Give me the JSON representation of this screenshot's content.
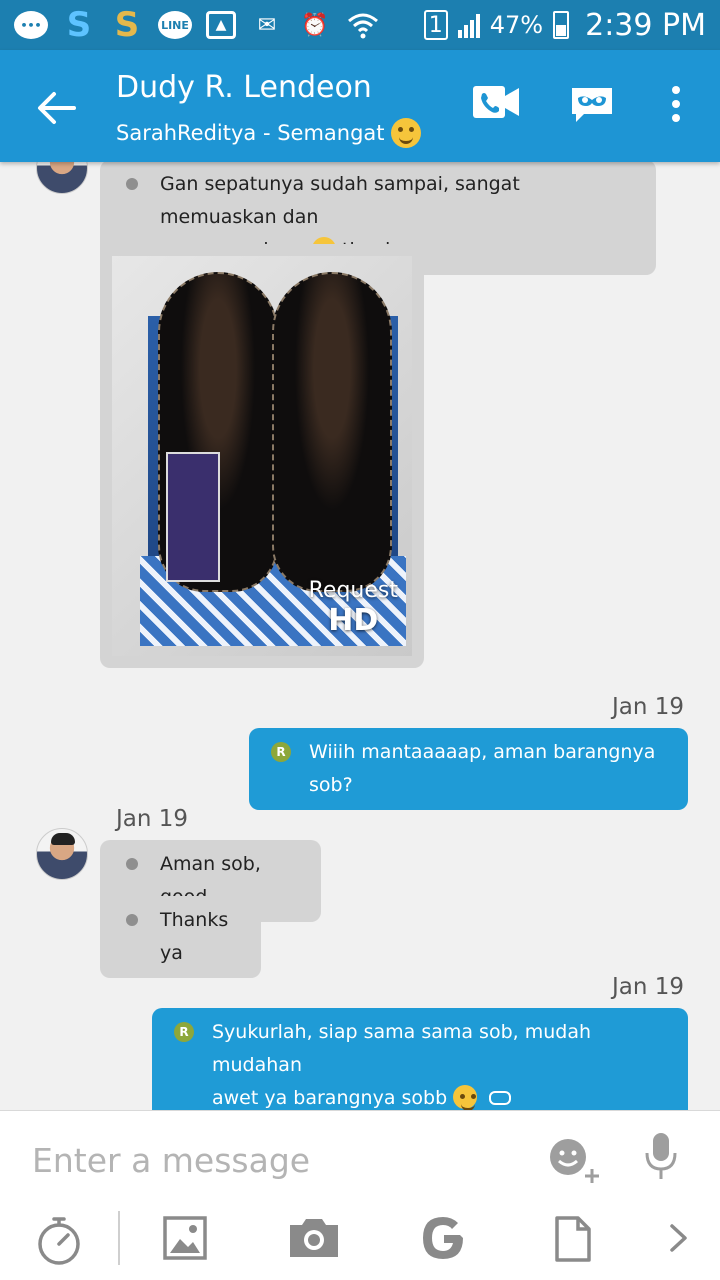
{
  "status_bar": {
    "battery": "47%",
    "time": "2:39 PM",
    "sim_slot": "1",
    "notification_icons": [
      "messages-icon",
      "s-blue-icon",
      "s-gold-icon",
      "line-icon",
      "gallery-icon",
      "mail-icon",
      "alarm-icon",
      "wifi-icon"
    ]
  },
  "header": {
    "contact_name": "Dudy R. Lendeon",
    "status_message": "SarahReditya - Semangat",
    "icons": [
      "back-arrow-icon",
      "video-call-icon",
      "chat-mask-icon",
      "more-icon"
    ]
  },
  "messages": [
    {
      "direction": "in",
      "text_line1": "Gan sepatunya sudah sampai, sangat memuaskan dan",
      "text_line2_before": "semoga sukses",
      "text_line2_after": "thanks"
    },
    {
      "direction": "in",
      "type": "image",
      "image_desc": "shoes-photo",
      "hd_request": "Request",
      "hd_label": "HD"
    },
    {
      "direction": "out",
      "date": "Jan 19",
      "badge": "R",
      "text": "Wiiih mantaaaaap, aman barangnya sob?"
    },
    {
      "direction": "in",
      "date": "Jan 19",
      "text": "Aman sob, good"
    },
    {
      "direction": "in",
      "text": "Thanks ya"
    },
    {
      "direction": "out",
      "date": "Jan 19",
      "badge": "R",
      "text_line1": "Syukurlah, siap sama sama sob, mudah mudahan",
      "text_line2": "awet ya barangnya sobb"
    }
  ],
  "input_bar": {
    "placeholder": "Enter a message",
    "icons": [
      "emoji-add-icon",
      "microphone-icon"
    ],
    "toolbar": [
      "timer-icon",
      "image-icon",
      "camera-icon",
      "google-icon",
      "file-icon",
      "chevron-right-icon"
    ]
  },
  "colors": {
    "status_bar": "#1c7fb0",
    "header": "#1e95d4",
    "outgoing_bubble": "#1f9bd6",
    "incoming_bubble": "#d4d4d4",
    "badge": "#8da73a"
  }
}
